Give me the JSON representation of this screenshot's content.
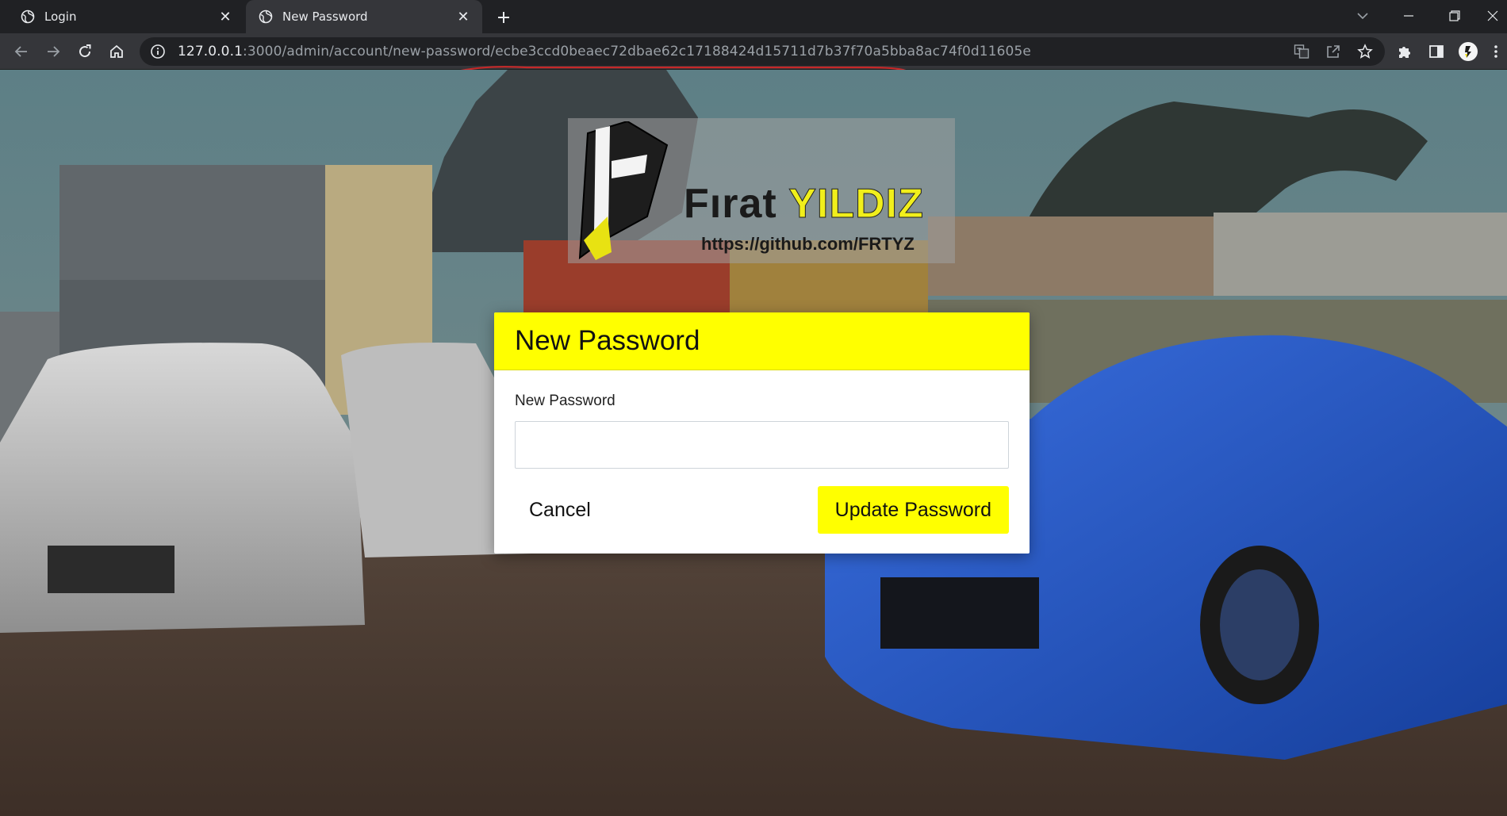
{
  "browser": {
    "tabs": [
      {
        "label": "Login",
        "active": false
      },
      {
        "label": "New Password",
        "active": true
      }
    ],
    "address": {
      "host": "127.0.0.1",
      "rest": ":3000/admin/account/new-password/ecbe3ccd0beaec72dbae62c17188424d15711d7b37f70a5bba8ac74f0d11605e"
    },
    "colors": {
      "tabstrip": "#202124",
      "toolbar": "#35363a",
      "omnibox": "#202124",
      "url_underline": "#c62828"
    }
  },
  "watermark": {
    "name_part1": "Fırat ",
    "name_part2": "YILDIZ",
    "link": "https://github.com/FRTYZ",
    "logo_letter": "F"
  },
  "modal": {
    "title": "New Password",
    "field_label": "New Password",
    "field_value": "",
    "field_placeholder": "",
    "cancel_label": "Cancel",
    "submit_label": "Update Password",
    "colors": {
      "accent": "#ffff00",
      "background": "#ffffff"
    }
  }
}
